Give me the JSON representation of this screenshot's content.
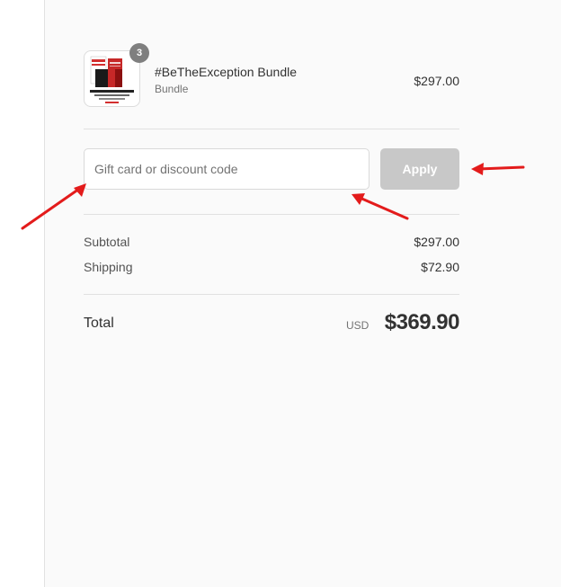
{
  "cart": {
    "item": {
      "quantity_badge": "3",
      "name": "#BeTheException Bundle",
      "variant": "Bundle",
      "price": "$297.00",
      "thumbnail": {
        "title_text": "#BeTheException Bundle",
        "promo_text": "SAVE $XX",
        "colors": [
          "#d32f2f",
          "#8b1010",
          "#1a1a1a"
        ]
      }
    }
  },
  "discount": {
    "placeholder": "Gift card or discount code",
    "apply_label": "Apply"
  },
  "totals": {
    "subtotal_label": "Subtotal",
    "subtotal_value": "$297.00",
    "shipping_label": "Shipping",
    "shipping_value": "$72.90",
    "total_label": "Total",
    "currency": "USD",
    "total_value": "$369.90"
  },
  "annotations": {
    "arrow_color": "#e31b1b",
    "arrow_count": 3
  }
}
